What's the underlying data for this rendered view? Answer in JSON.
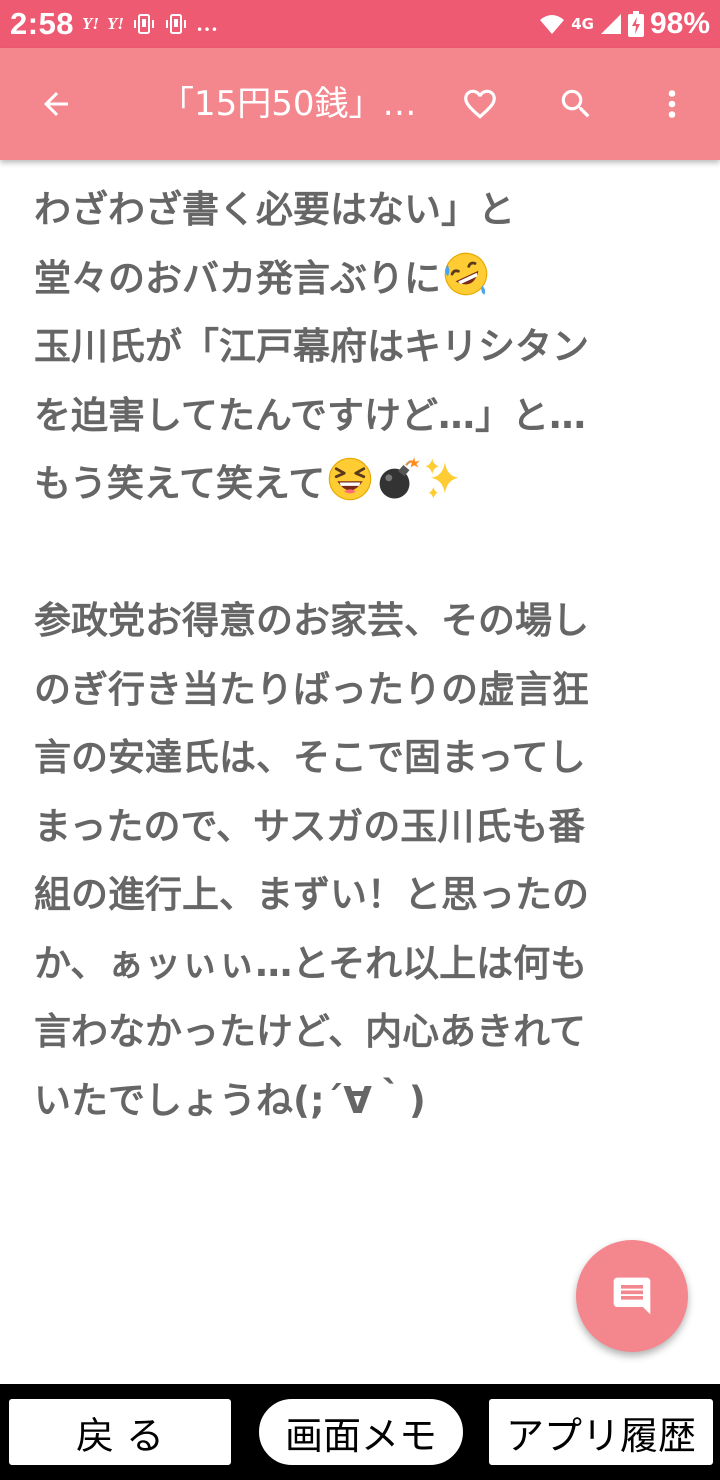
{
  "status_bar": {
    "time": "2:58",
    "notif_icons": [
      "Y!",
      "Y!"
    ],
    "more": "…",
    "network": "4G",
    "battery": "98%"
  },
  "app_bar": {
    "title": "「15円50銭」…",
    "icons": [
      "back-arrow-icon",
      "heart-icon",
      "search-icon",
      "more-vert-icon"
    ]
  },
  "content": {
    "lines": [
      "わざわざ書く必要はない」と",
      "堂々のおバカ発言ぶりに",
      "玉川氏が「江戸幕府はキリシタン",
      "を迫害してたんですけど…」と…",
      "もう笑えて笑えて",
      "",
      "参政党お得意のお家芸、その場し",
      "のぎ行き当たりばったりの虚言狂",
      "言の安達氏は、そこで固まってし",
      "まったので、サスガの玉川氏も番",
      "組の進行上、まずい！と思ったの",
      "か、ぁッぃぃ…とそれ以上は何も",
      "言わなかったけど、内心あきれて",
      "いたでしょうね(;´∀｀)"
    ],
    "emojis": [
      "rofl-emoji",
      "laughing-emoji",
      "bomb-emoji",
      "sparkles-emoji"
    ]
  },
  "bottom_bar": {
    "back_label": "戻 る",
    "memo_label": "画面メモ",
    "history_label": "アプリ履歴"
  },
  "colors": {
    "status_bar": "#ef5a73",
    "app_bar": "#f4868d",
    "text": "#666666",
    "fab": "#f4868d"
  }
}
